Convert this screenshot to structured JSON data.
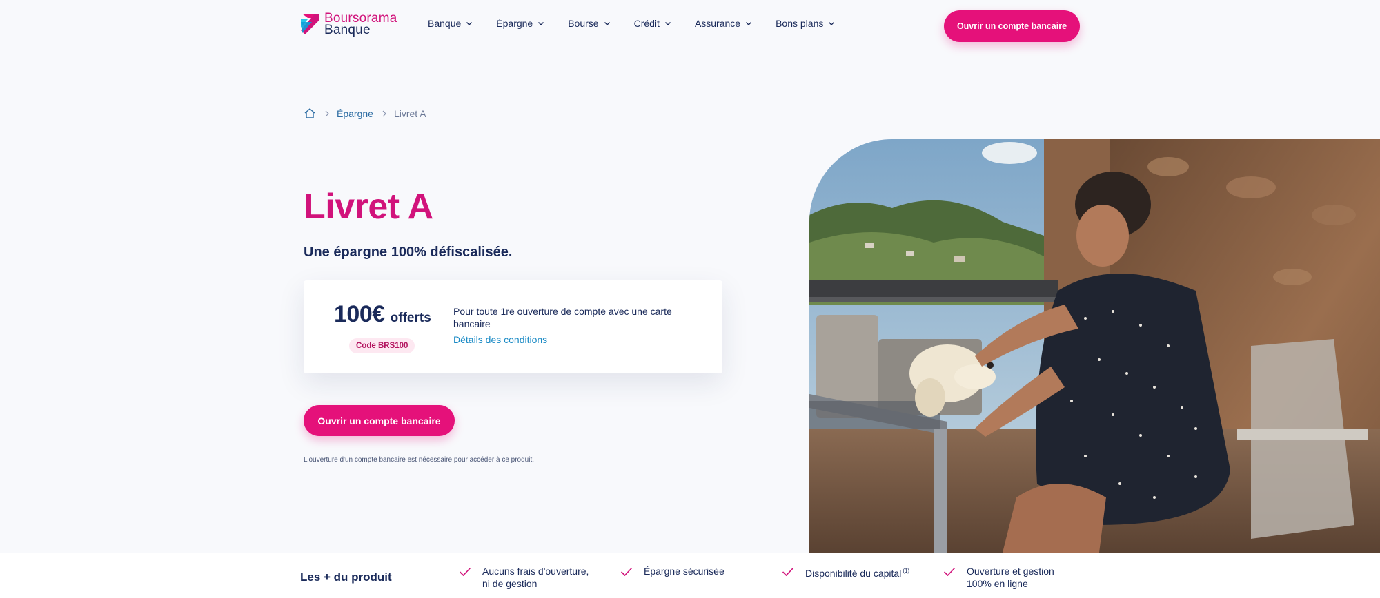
{
  "logo": {
    "line1": "Boursorama",
    "line2": "Banque"
  },
  "nav": {
    "items": [
      {
        "label": "Banque"
      },
      {
        "label": "Épargne"
      },
      {
        "label": "Bourse"
      },
      {
        "label": "Crédit"
      },
      {
        "label": "Assurance"
      },
      {
        "label": "Bons plans"
      }
    ]
  },
  "header": {
    "cta_label": "Ouvrir un compte bancaire"
  },
  "breadcrumb": {
    "items": [
      {
        "label": "Épargne"
      },
      {
        "label": "Livret A"
      }
    ]
  },
  "hero": {
    "title": "Livret A",
    "subtitle": "Une épargne 100% défiscalisée.",
    "offer": {
      "amount": "100€",
      "amount_suffix": "offerts",
      "code": "Code BRS100",
      "description": "Pour toute 1re ouverture de compte avec une carte bancaire",
      "link": "Détails des conditions"
    },
    "cta_label": "Ouvrir un compte bancaire",
    "note": "L'ouverture d'un compte bancaire est nécessaire pour accéder à ce produit."
  },
  "features": {
    "title": "Les + du produit",
    "items": [
      {
        "line1": "Aucuns frais d'ouverture,",
        "line2": "ni de gestion"
      },
      {
        "line1": "Épargne sécurisée",
        "line2": ""
      },
      {
        "line1": "Disponibilité du capital",
        "line2": "",
        "sup": "(1)"
      },
      {
        "line1": "Ouverture et gestion",
        "line2": "100% en ligne"
      }
    ]
  },
  "colors": {
    "brand_pink": "#e5117a",
    "title_pink": "#d1137b",
    "navy": "#1a2a5a",
    "link_blue": "#1a8ac5",
    "background": "#f8f9fc"
  }
}
